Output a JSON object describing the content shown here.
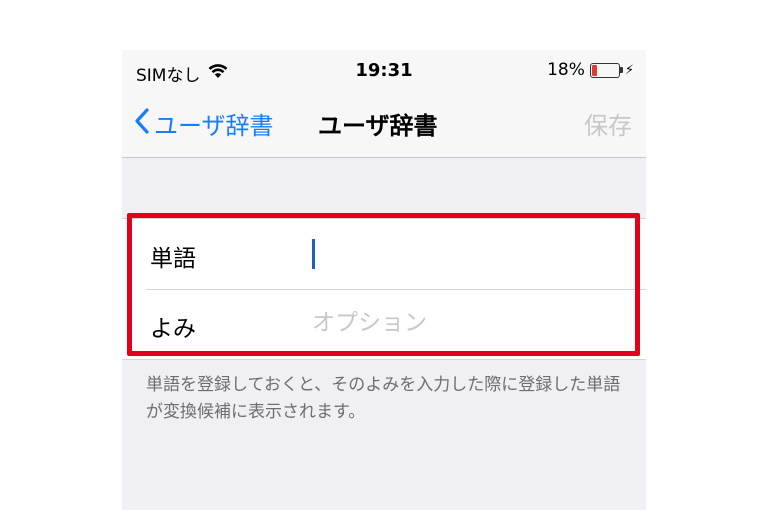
{
  "status_bar": {
    "carrier": "SIMなし",
    "wifi_icon": "wifi-icon",
    "time": "19:31",
    "battery_percent": "18%",
    "battery_level": 0.18,
    "charging_icon": "⚡"
  },
  "nav": {
    "back_label": "ユーザ辞書",
    "title": "ユーザ辞書",
    "save_label": "保存"
  },
  "form": {
    "word_label": "単語",
    "word_value": "",
    "reading_label": "よみ",
    "reading_placeholder": "オプション"
  },
  "footer": {
    "note": "単語を登録しておくと、そのよみを入力した際に登録した単語が変換候補に表示されます。"
  },
  "colors": {
    "accent": "#147efb",
    "highlight": "#e3001b",
    "battery": "#e53935"
  }
}
